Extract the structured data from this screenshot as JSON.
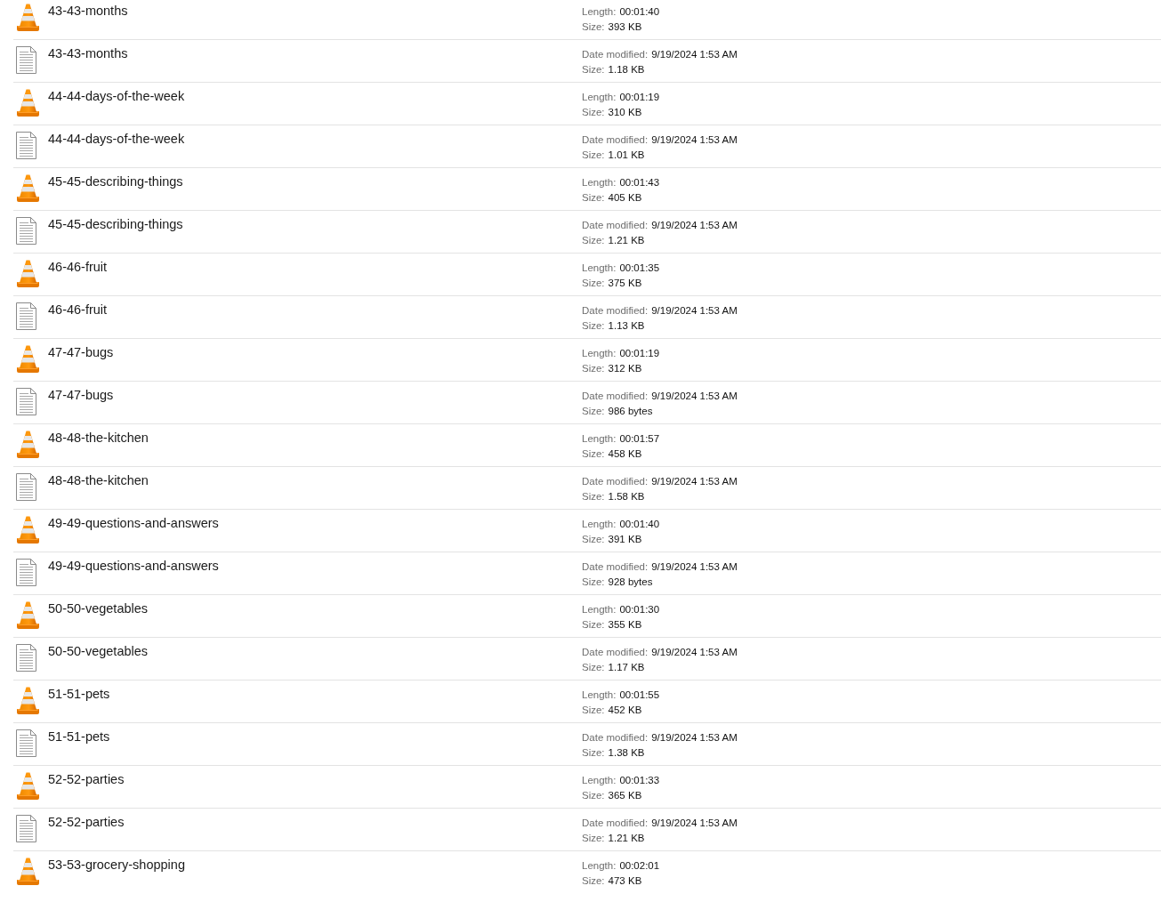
{
  "files": [
    {
      "kind": "video",
      "name": "43-43-months",
      "details": [
        {
          "label": "Length:",
          "value": "00:01:40"
        },
        {
          "label": "Size:",
          "value": "393 KB"
        }
      ]
    },
    {
      "kind": "text",
      "name": "43-43-months",
      "details": [
        {
          "label": "Date modified:",
          "value": "9/19/2024 1:53 AM"
        },
        {
          "label": "Size:",
          "value": "1.18 KB"
        }
      ]
    },
    {
      "kind": "video",
      "name": "44-44-days-of-the-week",
      "details": [
        {
          "label": "Length:",
          "value": "00:01:19"
        },
        {
          "label": "Size:",
          "value": "310 KB"
        }
      ]
    },
    {
      "kind": "text",
      "name": "44-44-days-of-the-week",
      "details": [
        {
          "label": "Date modified:",
          "value": "9/19/2024 1:53 AM"
        },
        {
          "label": "Size:",
          "value": "1.01 KB"
        }
      ]
    },
    {
      "kind": "video",
      "name": "45-45-describing-things",
      "details": [
        {
          "label": "Length:",
          "value": "00:01:43"
        },
        {
          "label": "Size:",
          "value": "405 KB"
        }
      ]
    },
    {
      "kind": "text",
      "name": "45-45-describing-things",
      "details": [
        {
          "label": "Date modified:",
          "value": "9/19/2024 1:53 AM"
        },
        {
          "label": "Size:",
          "value": "1.21 KB"
        }
      ]
    },
    {
      "kind": "video",
      "name": "46-46-fruit",
      "details": [
        {
          "label": "Length:",
          "value": "00:01:35"
        },
        {
          "label": "Size:",
          "value": "375 KB"
        }
      ]
    },
    {
      "kind": "text",
      "name": "46-46-fruit",
      "details": [
        {
          "label": "Date modified:",
          "value": "9/19/2024 1:53 AM"
        },
        {
          "label": "Size:",
          "value": "1.13 KB"
        }
      ]
    },
    {
      "kind": "video",
      "name": "47-47-bugs",
      "details": [
        {
          "label": "Length:",
          "value": "00:01:19"
        },
        {
          "label": "Size:",
          "value": "312 KB"
        }
      ]
    },
    {
      "kind": "text",
      "name": "47-47-bugs",
      "details": [
        {
          "label": "Date modified:",
          "value": "9/19/2024 1:53 AM"
        },
        {
          "label": "Size:",
          "value": "986 bytes"
        }
      ]
    },
    {
      "kind": "video",
      "name": "48-48-the-kitchen",
      "details": [
        {
          "label": "Length:",
          "value": "00:01:57"
        },
        {
          "label": "Size:",
          "value": "458 KB"
        }
      ]
    },
    {
      "kind": "text",
      "name": "48-48-the-kitchen",
      "details": [
        {
          "label": "Date modified:",
          "value": "9/19/2024 1:53 AM"
        },
        {
          "label": "Size:",
          "value": "1.58 KB"
        }
      ]
    },
    {
      "kind": "video",
      "name": "49-49-questions-and-answers",
      "details": [
        {
          "label": "Length:",
          "value": "00:01:40"
        },
        {
          "label": "Size:",
          "value": "391 KB"
        }
      ]
    },
    {
      "kind": "text",
      "name": "49-49-questions-and-answers",
      "details": [
        {
          "label": "Date modified:",
          "value": "9/19/2024 1:53 AM"
        },
        {
          "label": "Size:",
          "value": "928 bytes"
        }
      ]
    },
    {
      "kind": "video",
      "name": "50-50-vegetables",
      "details": [
        {
          "label": "Length:",
          "value": "00:01:30"
        },
        {
          "label": "Size:",
          "value": "355 KB"
        }
      ]
    },
    {
      "kind": "text",
      "name": "50-50-vegetables",
      "details": [
        {
          "label": "Date modified:",
          "value": "9/19/2024 1:53 AM"
        },
        {
          "label": "Size:",
          "value": "1.17 KB"
        }
      ]
    },
    {
      "kind": "video",
      "name": "51-51-pets",
      "details": [
        {
          "label": "Length:",
          "value": "00:01:55"
        },
        {
          "label": "Size:",
          "value": "452 KB"
        }
      ]
    },
    {
      "kind": "text",
      "name": "51-51-pets",
      "details": [
        {
          "label": "Date modified:",
          "value": "9/19/2024 1:53 AM"
        },
        {
          "label": "Size:",
          "value": "1.38 KB"
        }
      ]
    },
    {
      "kind": "video",
      "name": "52-52-parties",
      "details": [
        {
          "label": "Length:",
          "value": "00:01:33"
        },
        {
          "label": "Size:",
          "value": "365 KB"
        }
      ]
    },
    {
      "kind": "text",
      "name": "52-52-parties",
      "details": [
        {
          "label": "Date modified:",
          "value": "9/19/2024 1:53 AM"
        },
        {
          "label": "Size:",
          "value": "1.21 KB"
        }
      ]
    },
    {
      "kind": "video",
      "name": "53-53-grocery-shopping",
      "details": [
        {
          "label": "Length:",
          "value": "00:02:01"
        },
        {
          "label": "Size:",
          "value": "473 KB"
        }
      ]
    }
  ]
}
